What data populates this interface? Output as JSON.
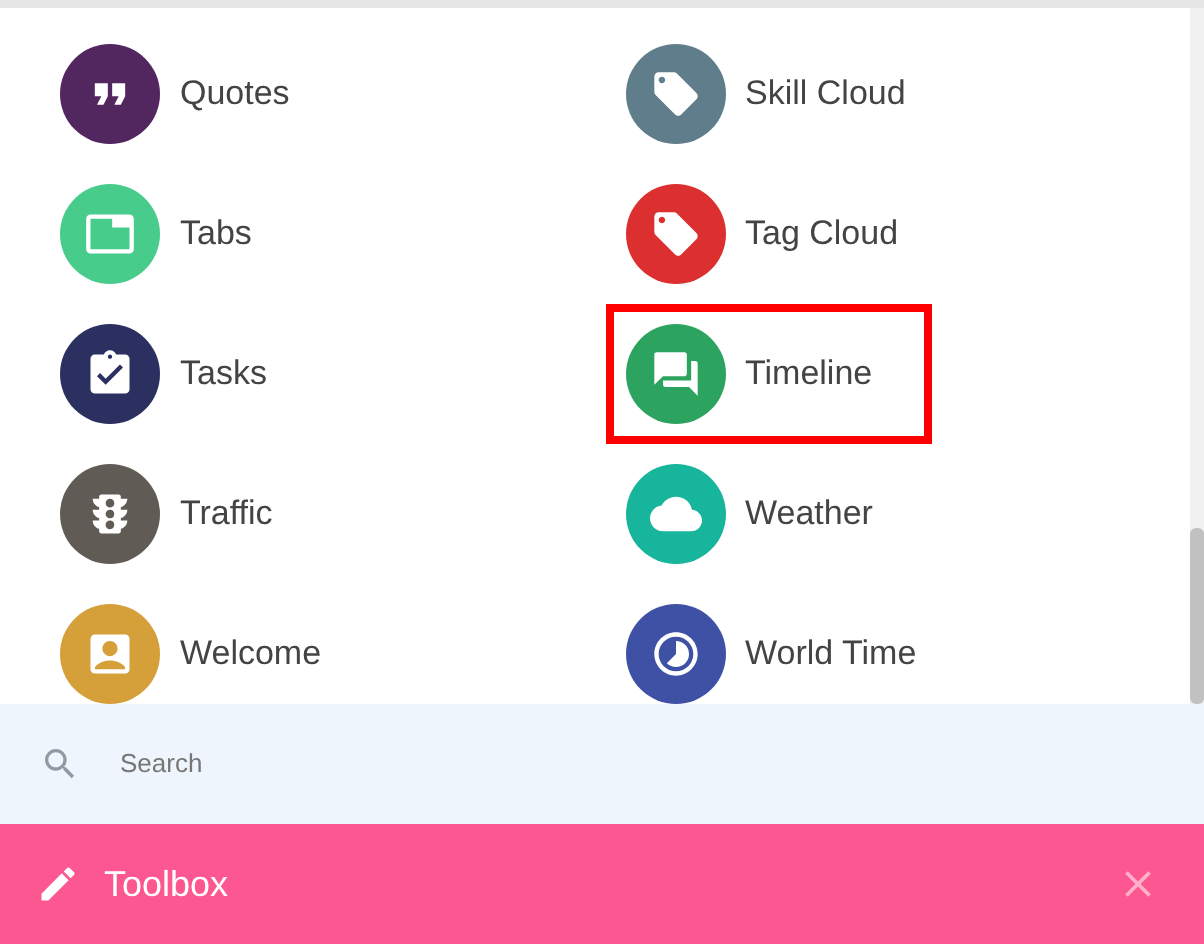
{
  "widgets": [
    {
      "label": "Quotes",
      "color": "#52275f",
      "highlighted": false
    },
    {
      "label": "Skill Cloud",
      "color": "#607d8b",
      "highlighted": false
    },
    {
      "label": "Tabs",
      "color": "#47cc8c",
      "highlighted": false
    },
    {
      "label": "Tag Cloud",
      "color": "#dc2f2f",
      "highlighted": false
    },
    {
      "label": "Tasks",
      "color": "#2b3061",
      "highlighted": false
    },
    {
      "label": "Timeline",
      "color": "#2ca460",
      "highlighted": true
    },
    {
      "label": "Traffic",
      "color": "#605c55",
      "highlighted": false
    },
    {
      "label": "Weather",
      "color": "#16b59c",
      "highlighted": false
    },
    {
      "label": "Welcome",
      "color": "#d5a03a",
      "highlighted": false
    },
    {
      "label": "World Time",
      "color": "#3f51a5",
      "highlighted": false
    }
  ],
  "search": {
    "placeholder": "Search"
  },
  "toolbar": {
    "title": "Toolbox"
  }
}
